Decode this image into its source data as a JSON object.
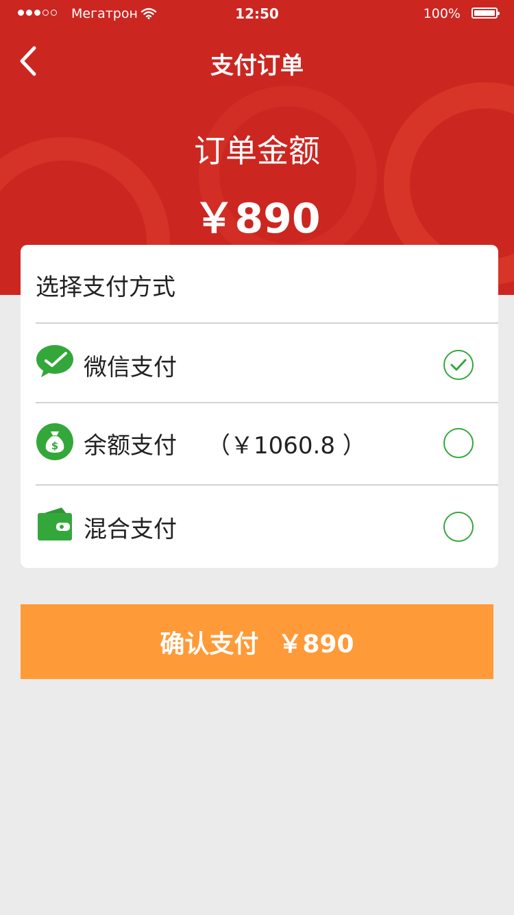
{
  "status_bar": {
    "carrier": "Мегатрон",
    "time": "12:50",
    "battery": "100%"
  },
  "header": {
    "title": "支付订单",
    "amount_label": "订单金额",
    "amount_value": "￥890"
  },
  "payment": {
    "section_title": "选择支付方式",
    "methods": [
      {
        "label": "微信支付",
        "extra": "",
        "icon": "wechat-icon",
        "selected": true
      },
      {
        "label": "余额支付",
        "extra": "（￥1060.8 ）",
        "icon": "money-bag-icon",
        "selected": false
      },
      {
        "label": "混合支付",
        "extra": "",
        "icon": "wallet-icon",
        "selected": false
      }
    ]
  },
  "confirm": {
    "label": "确认支付",
    "amount": "￥890"
  },
  "colors": {
    "header_red": "#cc2621",
    "accent_green": "#34a73b",
    "button_orange": "#ff9a38",
    "page_bg": "#ebebeb"
  }
}
